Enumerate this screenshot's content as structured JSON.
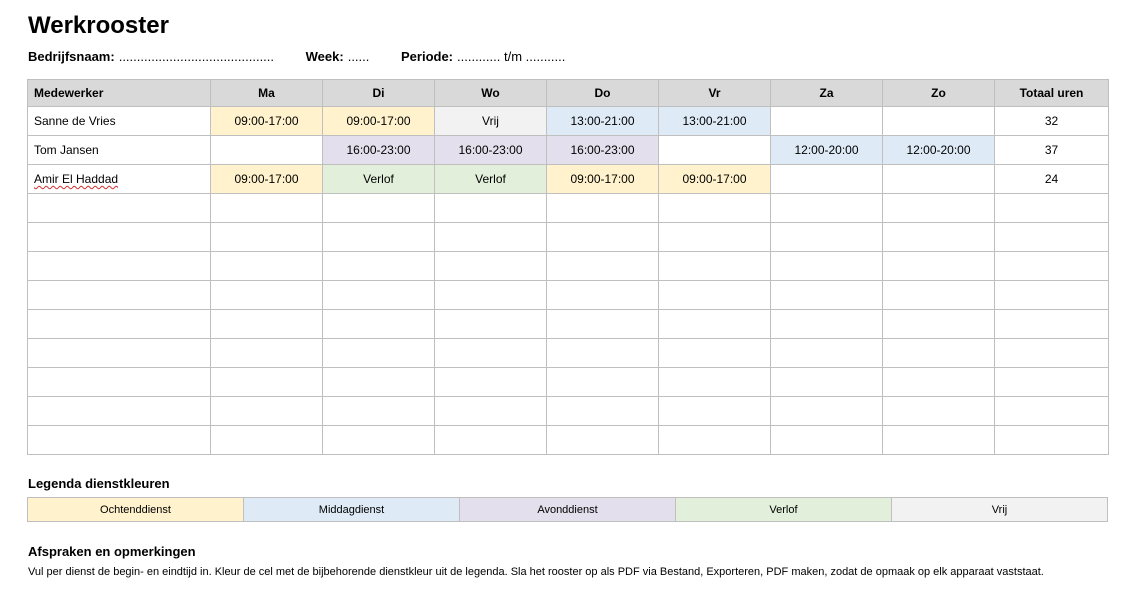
{
  "doc": {
    "title": "Werkrooster",
    "meta": {
      "company_label": "Bedrijfsnaam:",
      "company_value": "...........................................",
      "week_label": "Week:",
      "week_value": "......",
      "period_label": "Periode:",
      "period_value": "............ t/m ..........."
    }
  },
  "colors": {
    "ochtend": "#fff2cc",
    "middag": "#deebf7",
    "avond": "#e4dfec",
    "verlof": "#e2efda",
    "vrij": "#f2f2f2",
    "header": "#d9d9d9",
    "grid": "#bfbfbf"
  },
  "table": {
    "headers": [
      "Medewerker",
      "Ma",
      "Di",
      "Wo",
      "Do",
      "Vr",
      "Za",
      "Zo",
      "Totaal uren"
    ],
    "rows": [
      {
        "name": "Sanne de Vries",
        "days": [
          {
            "text": "09:00-17:00",
            "type": "ochtend"
          },
          {
            "text": "09:00-17:00",
            "type": "ochtend"
          },
          {
            "text": "Vrij",
            "type": "vrij"
          },
          {
            "text": "13:00-21:00",
            "type": "middag"
          },
          {
            "text": "13:00-21:00",
            "type": "middag"
          },
          {
            "text": "",
            "type": ""
          },
          {
            "text": "",
            "type": ""
          }
        ],
        "total": "32"
      },
      {
        "name": "Tom Jansen",
        "days": [
          {
            "text": "",
            "type": ""
          },
          {
            "text": "16:00-23:00",
            "type": "avond"
          },
          {
            "text": "16:00-23:00",
            "type": "avond"
          },
          {
            "text": "16:00-23:00",
            "type": "avond"
          },
          {
            "text": "",
            "type": ""
          },
          {
            "text": "12:00-20:00",
            "type": "middag"
          },
          {
            "text": "12:00-20:00",
            "type": "middag"
          }
        ],
        "total": "37"
      },
      {
        "name": "Amir El Haddad",
        "days": [
          {
            "text": "09:00-17:00",
            "type": "ochtend"
          },
          {
            "text": "Verlof",
            "type": "verlof"
          },
          {
            "text": "Verlof",
            "type": "verlof"
          },
          {
            "text": "09:00-17:00",
            "type": "ochtend"
          },
          {
            "text": "09:00-17:00",
            "type": "ochtend"
          },
          {
            "text": "",
            "type": ""
          },
          {
            "text": "",
            "type": ""
          }
        ],
        "total": "24"
      }
    ],
    "empty_rows": 9
  },
  "legend": {
    "title": "Legenda dienstkleuren",
    "items": [
      {
        "label": "Ochtenddienst",
        "type": "ochtend"
      },
      {
        "label": "Middagdienst",
        "type": "middag"
      },
      {
        "label": "Avonddienst",
        "type": "avond"
      },
      {
        "label": "Verlof",
        "type": "verlof"
      },
      {
        "label": "Vrij",
        "type": "vrij"
      }
    ]
  },
  "notes": {
    "title": "Afspraken en opmerkingen",
    "text": "Vul per dienst de begin- en eindtijd in. Kleur de cel met de bijbehorende dienstkleur uit de legenda. Sla het rooster op als PDF via Bestand, Exporteren, PDF maken, zodat de opmaak op elk apparaat vaststaat."
  }
}
